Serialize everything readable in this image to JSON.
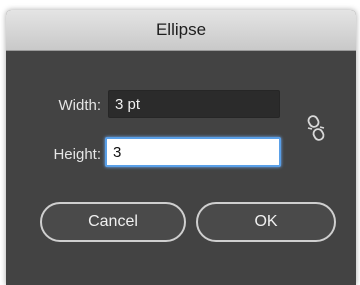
{
  "dialog": {
    "title": "Ellipse",
    "width_label": "Width:",
    "width_value": "3 pt",
    "height_label": "Height:",
    "height_value": "3",
    "constrain_icon": "broken-link-icon",
    "cancel_label": "Cancel",
    "ok_label": "OK"
  },
  "colors": {
    "dialog_background": "#434343",
    "titlebar": "#d6d6d6",
    "focus_ring": "#5aa0e8"
  }
}
